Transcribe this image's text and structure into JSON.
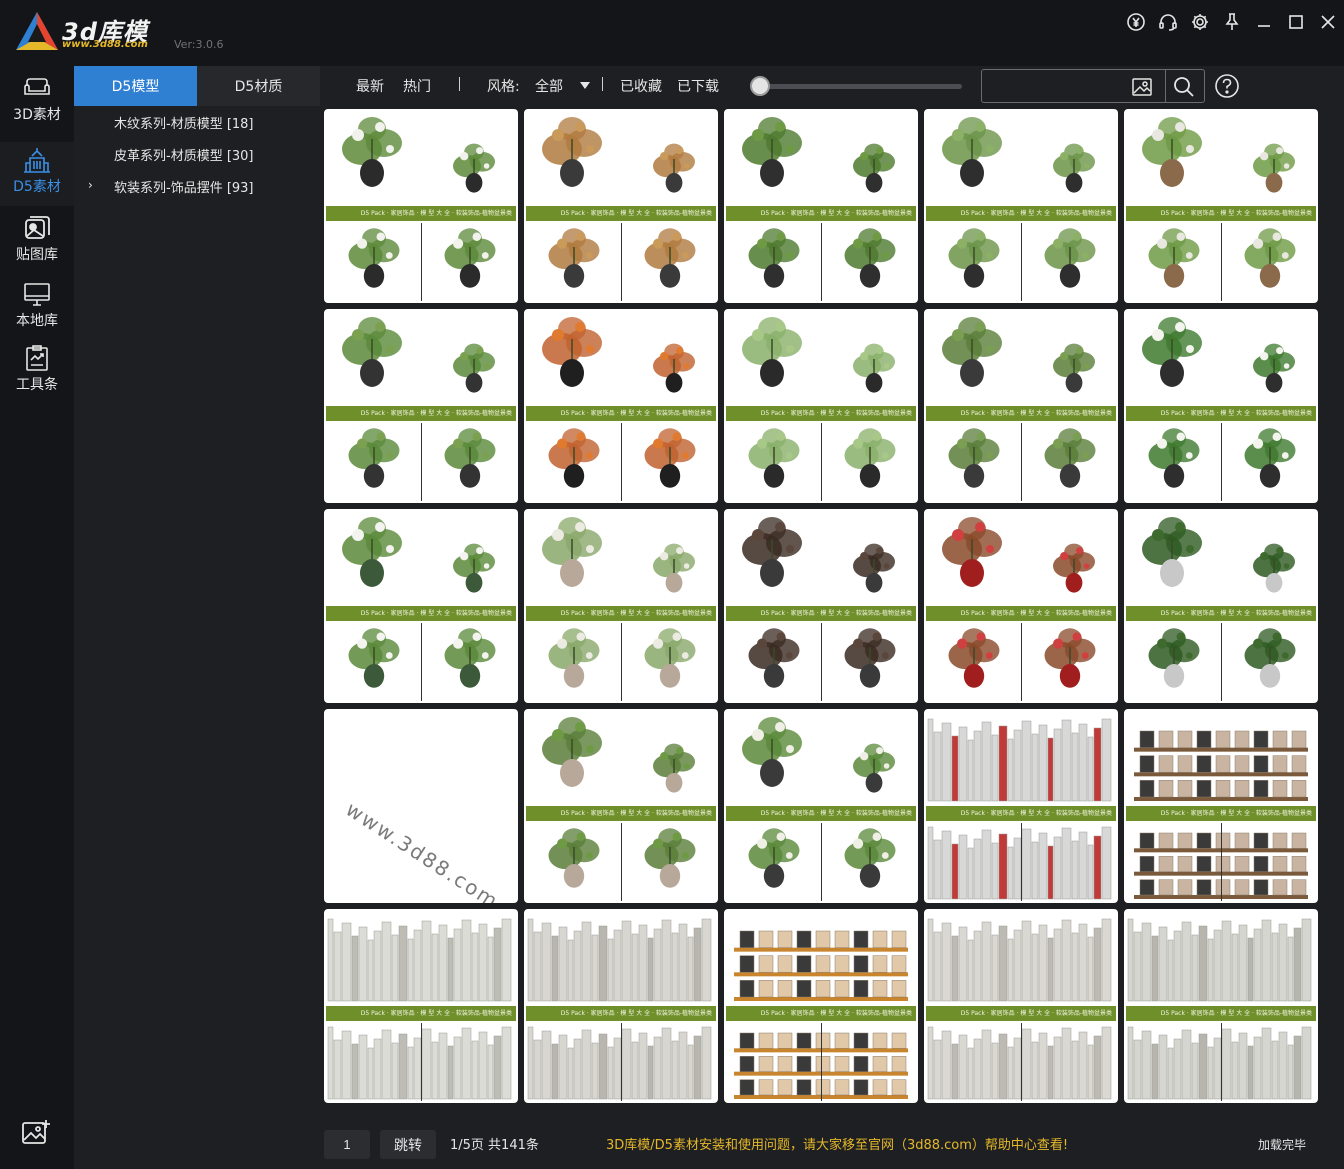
{
  "app": {
    "logo_text": "3d库模",
    "logo_url": "www.3d88.com",
    "version": "Ver:3.0.6"
  },
  "window_icons": [
    "yen-refresh-icon",
    "headset-icon",
    "gear-icon",
    "pin-icon",
    "minimize-icon",
    "maximize-icon",
    "close-icon"
  ],
  "rail": {
    "items": [
      {
        "label": "3D素材",
        "icon": "sofa-icon"
      },
      {
        "label": "D5素材",
        "icon": "building-icon",
        "active": true
      },
      {
        "label": "贴图库",
        "icon": "image-stack-icon"
      },
      {
        "label": "本地库",
        "icon": "monitor-icon"
      },
      {
        "label": "工具条",
        "icon": "clipboard-tools-icon"
      }
    ],
    "bottom_icon": "image-add-icon"
  },
  "category_tabs": [
    {
      "label": "D5模型",
      "active": true
    },
    {
      "label": "D5材质",
      "active": false
    }
  ],
  "categories": [
    {
      "label": "木纹系列-材质模型 [18]",
      "expandable": false
    },
    {
      "label": "皮革系列-材质模型 [30]",
      "expandable": false
    },
    {
      "label": "软装系列-饰品摆件 [93]",
      "expandable": true
    }
  ],
  "toolbar": {
    "latest": "最新",
    "popular": "热门",
    "style_label": "风格:",
    "style_value": "全部",
    "favorites": "已收藏",
    "downloaded": "已下载",
    "search_placeholder": ""
  },
  "colors": {
    "accent": "#2f7fd2",
    "band": "#6f8f2a",
    "notice": "#e5b829"
  },
  "grid": {
    "band_text": "D5 Pack · 家居饰品 · 模 型 大 全 · 软装饰品-植物盆景类",
    "cards": [
      {
        "kind": "plants",
        "pot": "#2b2b2b",
        "leaf": "#5d8a3a",
        "flower": "#f2f2ec"
      },
      {
        "kind": "plants",
        "pot": "#3a3a3a",
        "leaf": "#b07a3e",
        "flower": "#c99a5a"
      },
      {
        "kind": "plants",
        "pot": "#2f2f2f",
        "leaf": "#4e7a2e",
        "flower": "#6e9a44"
      },
      {
        "kind": "plants",
        "pot": "#2e2e2e",
        "leaf": "#6b9448",
        "flower": "#8bb066"
      },
      {
        "kind": "plants",
        "pot": "#8a6a4a",
        "leaf": "#6e9a44",
        "flower": "#e8e8e0"
      },
      {
        "kind": "plants",
        "pot": "#333333",
        "leaf": "#5a8a3a",
        "flower": "#7aa050"
      },
      {
        "kind": "plants",
        "pot": "#1f1f1f",
        "leaf": "#c0622e",
        "flower": "#e07a2e"
      },
      {
        "kind": "plants",
        "pot": "#2a2a2a",
        "leaf": "#8ab06a",
        "flower": "#a8c888"
      },
      {
        "kind": "plants",
        "pot": "#3a3a3a",
        "leaf": "#5a7e3a",
        "flower": "#7a9e52"
      },
      {
        "kind": "plants",
        "pot": "#2e2e2e",
        "leaf": "#3e7a2e",
        "flower": "#f4f4ee"
      },
      {
        "kind": "plants",
        "pot": "#3c5a3a",
        "leaf": "#5a8a3a",
        "flower": "#f3f3f0"
      },
      {
        "kind": "plants",
        "pot": "#b8a89a",
        "leaf": "#8aa86a",
        "flower": "#ecebe2"
      },
      {
        "kind": "plants",
        "pot": "#3a3a3a",
        "leaf": "#3a2a22",
        "flower": "#5a463a"
      },
      {
        "kind": "plants",
        "pot": "#a01e1e",
        "leaf": "#8a4a2a",
        "flower": "#d04040"
      },
      {
        "kind": "plants",
        "pot": "#c8c8c8",
        "leaf": "#2e5a22",
        "flower": "#3e6a2e"
      },
      {
        "kind": "watermark",
        "text": "www.3d88.com"
      },
      {
        "kind": "plants",
        "pot": "#b8a89a",
        "leaf": "#5a7e3a",
        "flower": "#6e9a44"
      },
      {
        "kind": "plants",
        "pot": "#3a3a3a",
        "leaf": "#5a8a3a",
        "flower": "#efefe6"
      },
      {
        "kind": "books",
        "book": "#d8d8d8",
        "accent": "#c03a3a"
      },
      {
        "kind": "shelf",
        "book": "#c8b4a0",
        "accent": "#7a5a3a"
      },
      {
        "kind": "books",
        "book": "#dcdcd6",
        "accent": "#bdbdb6"
      },
      {
        "kind": "books",
        "book": "#d8d6d0",
        "accent": "#b8b6ae"
      },
      {
        "kind": "shelf",
        "book": "#e0c8a8",
        "accent": "#c8852e"
      },
      {
        "kind": "books",
        "book": "#dad8d2",
        "accent": "#bcbab2"
      },
      {
        "kind": "books",
        "book": "#d6d6d0",
        "accent": "#b6b6ae"
      }
    ]
  },
  "footer": {
    "page_value": "1",
    "jump_label": "跳转",
    "page_info": "1/5页 共141条",
    "notice": "3D库模/D5素材安装和使用问题，请大家移至官网（3d88.com）帮助中心查看!",
    "load_status": "加载完毕"
  }
}
